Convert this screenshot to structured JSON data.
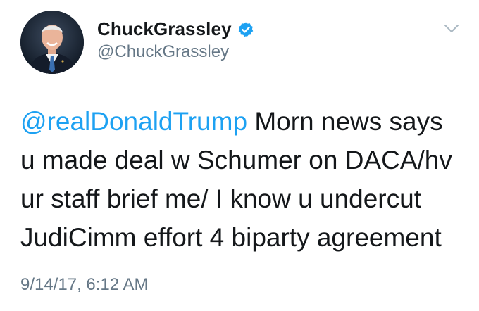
{
  "author": {
    "display_name": "ChuckGrassley",
    "handle": "@ChuckGrassley",
    "verified_icon": "verified-badge-icon",
    "avatar_icon": "profile-photo"
  },
  "tweet": {
    "mention": "@realDonaldTrump",
    "lines": [
      " Morn news says",
      "u made deal w Schumer on DACA/hv",
      "ur staff brief me/ I know u undercut",
      "JudiCimm effort 4 biparty agreement"
    ],
    "timestamp": "9/14/17, 6:12 AM"
  },
  "menu": {
    "icon": "chevron-down-icon"
  },
  "colors": {
    "mention": "#1da1f2",
    "verified": "#1da1f2",
    "text": "#14171a",
    "muted": "#657786"
  }
}
